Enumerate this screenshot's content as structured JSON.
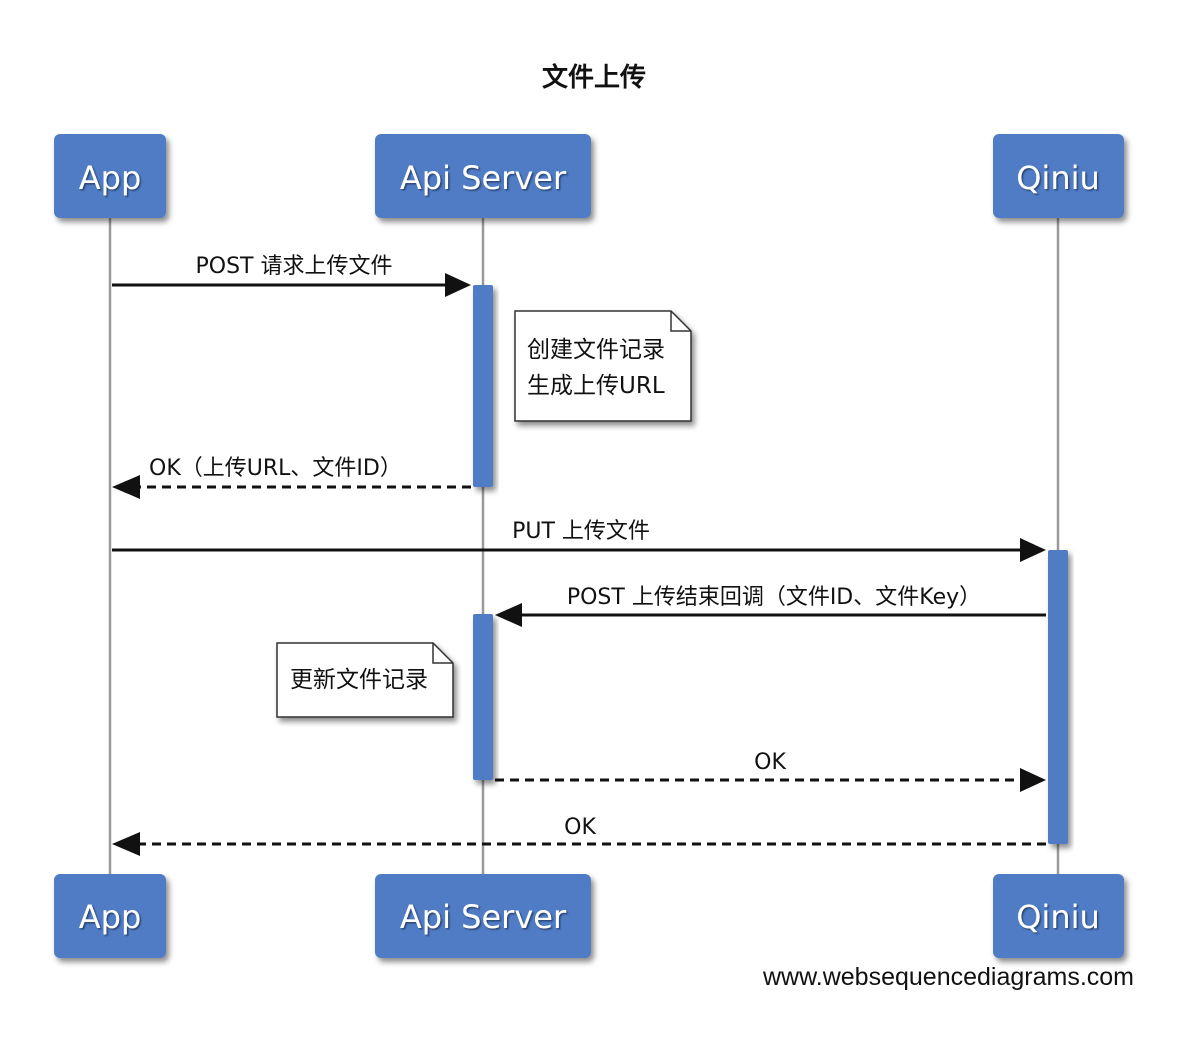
{
  "title": "文件上传",
  "participants": [
    {
      "id": "app",
      "label": "App"
    },
    {
      "id": "api",
      "label": "Api Server"
    },
    {
      "id": "qiniu",
      "label": "Qiniu"
    }
  ],
  "messages": [
    {
      "id": "m1",
      "label": "POST 请求上传文件",
      "from": "App",
      "to": "Api Server",
      "style": "solid"
    },
    {
      "id": "m2",
      "label": "OK（上传URL、文件ID）",
      "from": "Api Server",
      "to": "App",
      "style": "dashed"
    },
    {
      "id": "m3",
      "label": "PUT 上传文件",
      "from": "App",
      "to": "Qiniu",
      "style": "solid"
    },
    {
      "id": "m4",
      "label": "POST 上传结束回调（文件ID、文件Key）",
      "from": "Qiniu",
      "to": "Api Server",
      "style": "solid"
    },
    {
      "id": "m5",
      "label": "OK",
      "from": "Api Server",
      "to": "Qiniu",
      "style": "dashed"
    },
    {
      "id": "m6",
      "label": "OK",
      "from": "Qiniu",
      "to": "App",
      "style": "dashed"
    }
  ],
  "notes": [
    {
      "id": "n1",
      "lines": [
        "创建文件记录",
        "生成上传URL"
      ]
    },
    {
      "id": "n2",
      "lines": [
        "更新文件记录"
      ]
    }
  ],
  "watermark": "www.websequencediagrams.com",
  "colors": {
    "actor_fill": "#4f7cc4",
    "activation_fill": "#4f7cc4",
    "lifeline": "#999999",
    "arrow": "#111111",
    "note_fill": "#ffffff"
  }
}
